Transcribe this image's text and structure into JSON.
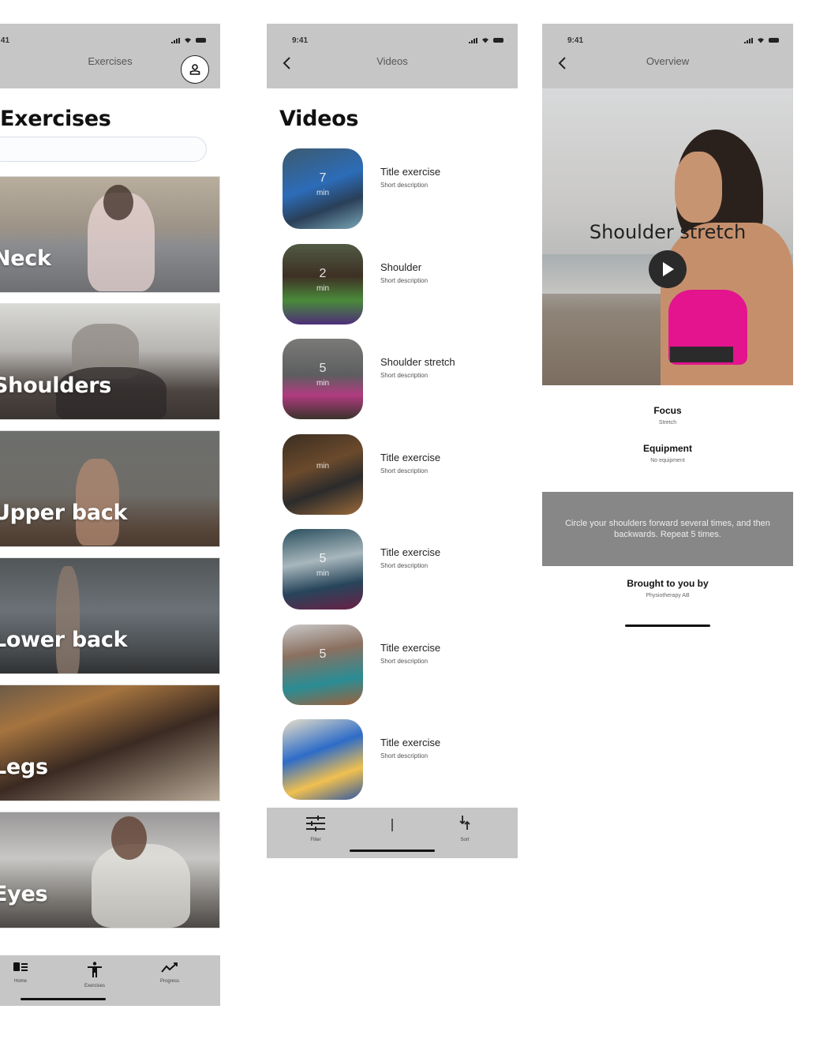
{
  "status_bar": {
    "time": "9:41"
  },
  "screens": {
    "exercises": {
      "nav_title": "Exercises",
      "heading": "Exercises",
      "search": {
        "value": "",
        "placeholder": ""
      },
      "categories": [
        {
          "label": "Neck"
        },
        {
          "label": "Shoulders"
        },
        {
          "label": "Upper back"
        },
        {
          "label": "Lower back"
        },
        {
          "label": "Legs"
        },
        {
          "label": "Eyes"
        }
      ],
      "tabs": [
        {
          "label": "Home",
          "icon": "home-icon"
        },
        {
          "label": "Exercises",
          "icon": "person-icon"
        },
        {
          "label": "Progress",
          "icon": "progress-icon"
        }
      ]
    },
    "videos": {
      "nav_title": "Videos",
      "heading": "Videos",
      "items": [
        {
          "title": "Title exercise",
          "description": "Short description",
          "duration": "7",
          "unit": "min"
        },
        {
          "title": "Shoulder",
          "description": "Short description",
          "duration": "2",
          "unit": "min"
        },
        {
          "title": "Shoulder stretch",
          "description": "Short description",
          "duration": "5",
          "unit": "min"
        },
        {
          "title": "Title exercise",
          "description": "Short description",
          "duration": "",
          "unit": "min"
        },
        {
          "title": "Title exercise",
          "description": "Short description",
          "duration": "5",
          "unit": "min"
        },
        {
          "title": "Title exercise",
          "description": "Short description",
          "duration": "5",
          "unit": ""
        },
        {
          "title": "Title exercise",
          "description": "Short description",
          "duration": "",
          "unit": ""
        }
      ],
      "toolbar": {
        "filter_label": "Filter",
        "sort_label": "Sort"
      }
    },
    "overview": {
      "nav_title": "Overview",
      "video_title": "Shoulder stretch",
      "focus_label": "Focus",
      "focus_value": "Stretch",
      "equipment_label": "Equipment",
      "equipment_value": "No equipment",
      "instructions": "Circle your shoulders forward several times, and then backwards. Repeat 5 times.",
      "credit_label": "Brought to you by",
      "credit_value": "Physiotherapy AB"
    }
  },
  "colors": {
    "bar_gray": "#c6c6c6",
    "instruction_bg": "#878787",
    "accent_pink": "#e3148e"
  }
}
